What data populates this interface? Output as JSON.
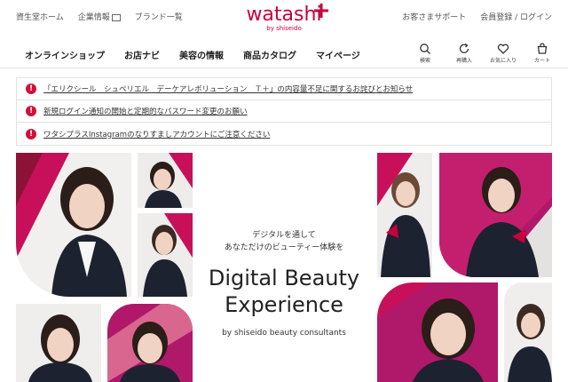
{
  "top_links_left": [
    {
      "label": "資生堂ホーム"
    },
    {
      "label": "企業情報"
    },
    {
      "label": "ブランド一覧"
    }
  ],
  "logo": {
    "word": "watashi",
    "sub": "by shiseido",
    "color": "#c8003c"
  },
  "top_links_right": [
    {
      "label": "お客さまサポート"
    },
    {
      "label": "会員登録 / ログイン"
    }
  ],
  "nav": {
    "items": [
      {
        "label": "オンラインショップ"
      },
      {
        "label": "お店ナビ"
      },
      {
        "label": "美容の情報"
      },
      {
        "label": "商品カタログ"
      },
      {
        "label": "マイページ"
      }
    ],
    "icons": [
      {
        "icon": "search-icon",
        "label": "検索"
      },
      {
        "icon": "refresh-icon",
        "label": "再購入"
      },
      {
        "icon": "heart-icon",
        "label": "お気に入り"
      },
      {
        "icon": "cart-icon",
        "label": "カート"
      }
    ]
  },
  "notices": [
    {
      "text": "「エリクシール　シュペリエル　デーケアレボリューション　Ｔ＋」の内容量不足に関するお詫びとお知らせ"
    },
    {
      "text": "新規ログイン通知の開始と定期的なパスワード変更のお願い"
    },
    {
      "text": "ワタシプラスInstagramのなりすましアカウントにご注意ください"
    }
  ],
  "hero": {
    "line1": "デジタルを通して",
    "line2": "あなただけのビューティー体験を",
    "title_line1": "Digital Beauty",
    "title_line2": "Experience",
    "byline": "by shiseido beauty consultants"
  },
  "colors": {
    "accent": "#c8003c",
    "magenta": "#b0186a",
    "pink": "#d9668f"
  }
}
